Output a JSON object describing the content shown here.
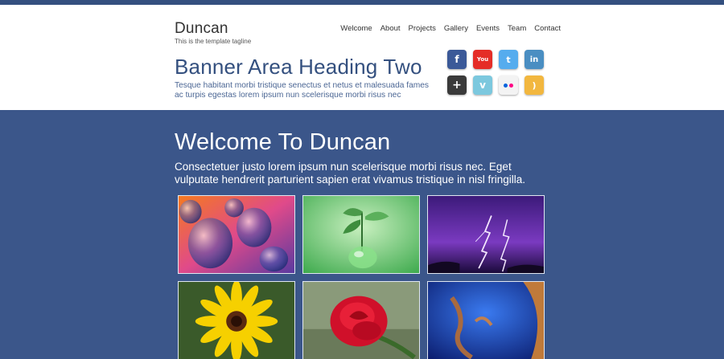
{
  "header": {
    "brand": "Duncan",
    "tagline": "This is the template tagline",
    "nav": [
      "Welcome",
      "About",
      "Projects",
      "Gallery",
      "Events",
      "Team",
      "Contact"
    ]
  },
  "banner": {
    "heading": "Banner Area Heading Two",
    "text": "Tesque habitant morbi tristique senectus et netus et malesuada fames ac turpis egestas lorem ipsum nun scelerisque morbi risus nec"
  },
  "social": [
    {
      "name": "facebook-icon",
      "glyph": "f"
    },
    {
      "name": "youtube-icon",
      "glyph": "You"
    },
    {
      "name": "twitter-icon",
      "glyph": "t"
    },
    {
      "name": "linkedin-icon",
      "glyph": "in"
    },
    {
      "name": "google-plus-icon",
      "glyph": "+"
    },
    {
      "name": "vimeo-icon",
      "glyph": "v"
    },
    {
      "name": "flickr-icon",
      "glyph": ""
    },
    {
      "name": "rss-icon",
      "glyph": ")"
    }
  ],
  "welcome": {
    "title": "Welcome To Duncan",
    "text": "Consectetuer justo lorem ipsum nun scelerisque morbi risus nec. Eget vulputate hendrerit parturient sapien erat vivamus tristique in nisl fringilla."
  },
  "gallery": [
    {
      "name": "bubbles"
    },
    {
      "name": "green-plant"
    },
    {
      "name": "lightning"
    },
    {
      "name": "yellow-flower"
    },
    {
      "name": "red-rose"
    },
    {
      "name": "blue-abstract"
    }
  ],
  "colors": {
    "primary": "#3b568a",
    "top_strip": "#34507f",
    "banner_heading": "#34507f"
  }
}
